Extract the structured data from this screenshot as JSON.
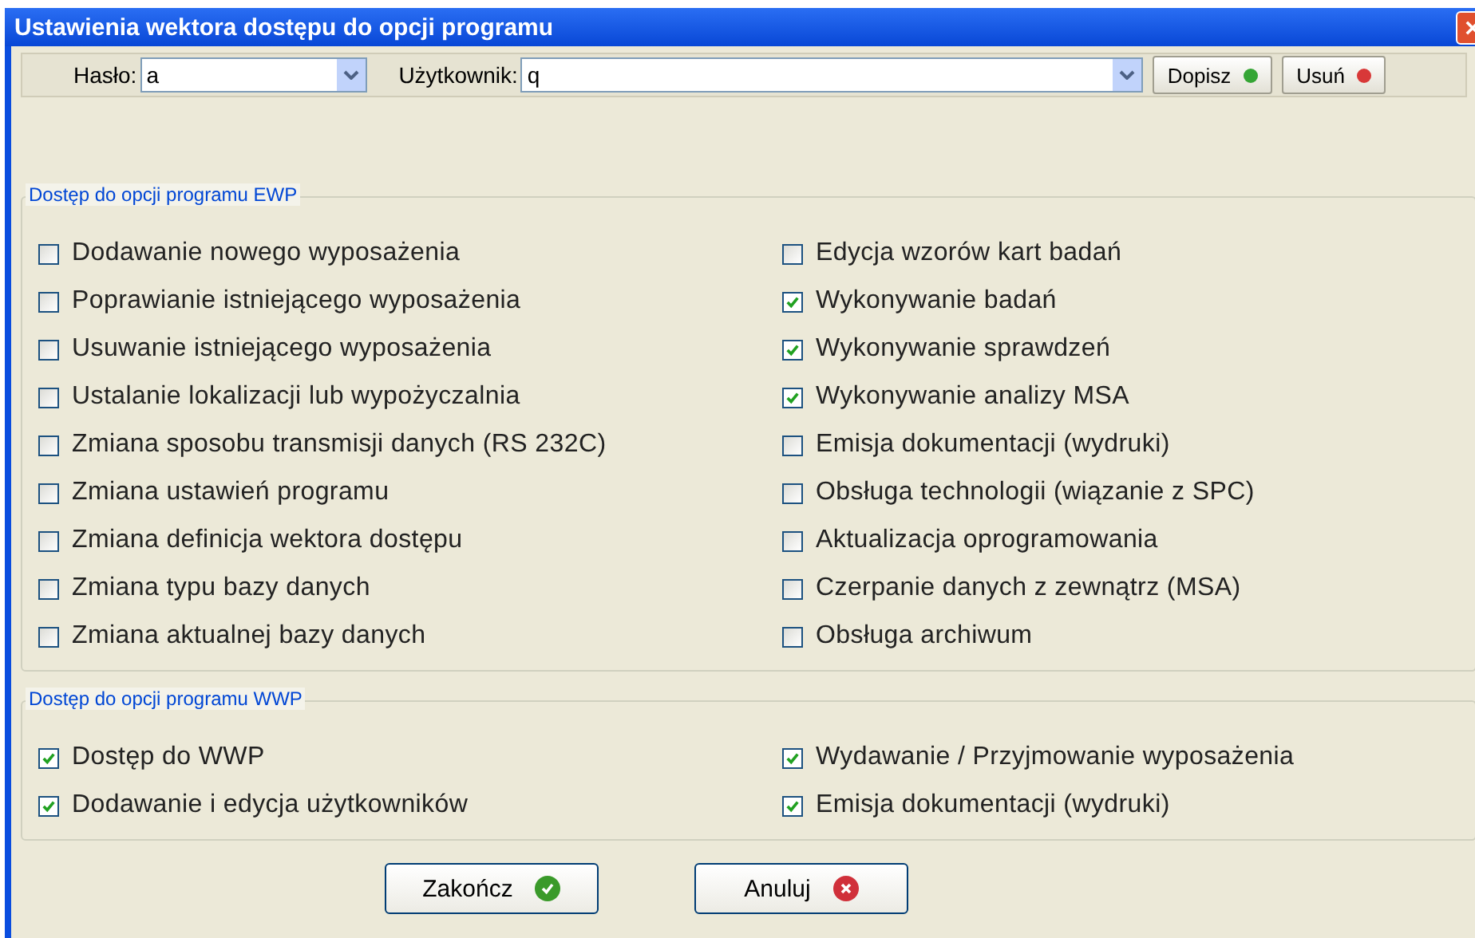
{
  "window": {
    "title": "Ustawienia wektora dostępu do opcji programu"
  },
  "toolbar": {
    "password_label": "Hasło:",
    "password_value": "a",
    "user_label": "Użytkownik:",
    "user_value": "q",
    "buttons": [
      {
        "label": "Dopisz",
        "kind": "add"
      },
      {
        "label": "Usuń",
        "kind": "remove"
      }
    ]
  },
  "groups": [
    {
      "title": "Dostęp do opcji programu EWP",
      "columns": [
        [
          {
            "label": "Dodawanie nowego wyposażenia",
            "checked": false
          },
          {
            "label": "Poprawianie istniejącego wyposażenia",
            "checked": false
          },
          {
            "label": "Usuwanie istniejącego wyposażenia",
            "checked": false
          },
          {
            "label": "Ustalanie lokalizacji  lub wypożyczalnia",
            "checked": false
          },
          {
            "label": "Zmiana sposobu transmisji danych (RS 232C)",
            "checked": false
          },
          {
            "label": "Zmiana ustawień programu",
            "checked": false
          },
          {
            "label": "Zmiana definicja wektora dostępu",
            "checked": false
          },
          {
            "label": "Zmiana typu bazy danych",
            "checked": false
          },
          {
            "label": "Zmiana aktualnej bazy danych",
            "checked": false
          }
        ],
        [
          {
            "label": "Edycja wzorów kart badań",
            "checked": false
          },
          {
            "label": "Wykonywanie badań",
            "checked": true
          },
          {
            "label": "Wykonywanie sprawdzeń",
            "checked": true
          },
          {
            "label": "Wykonywanie analizy MSA",
            "checked": true
          },
          {
            "label": "Emisja dokumentacji (wydruki)",
            "checked": false
          },
          {
            "label": "Obsługa technologii (wiązanie z SPC)",
            "checked": false
          },
          {
            "label": "Aktualizacja oprogramowania",
            "checked": false
          },
          {
            "label": "Czerpanie danych z zewnątrz (MSA)",
            "checked": false
          },
          {
            "label": "Obsługa archiwum",
            "checked": false
          }
        ]
      ]
    },
    {
      "title": "Dostęp do opcji programu WWP",
      "columns": [
        [
          {
            "label": "Dostęp do WWP",
            "checked": true
          },
          {
            "label": "Dodawanie i edycja użytkowników",
            "checked": true
          }
        ],
        [
          {
            "label": "Wydawanie / Przyjmowanie wyposażenia",
            "checked": true
          },
          {
            "label": "Emisja dokumentacji (wydruki)",
            "checked": true
          }
        ]
      ]
    }
  ],
  "buttons": [
    {
      "label": "Zakończ",
      "kind": "ok"
    },
    {
      "label": "Anuluj",
      "kind": "cancel"
    }
  ]
}
